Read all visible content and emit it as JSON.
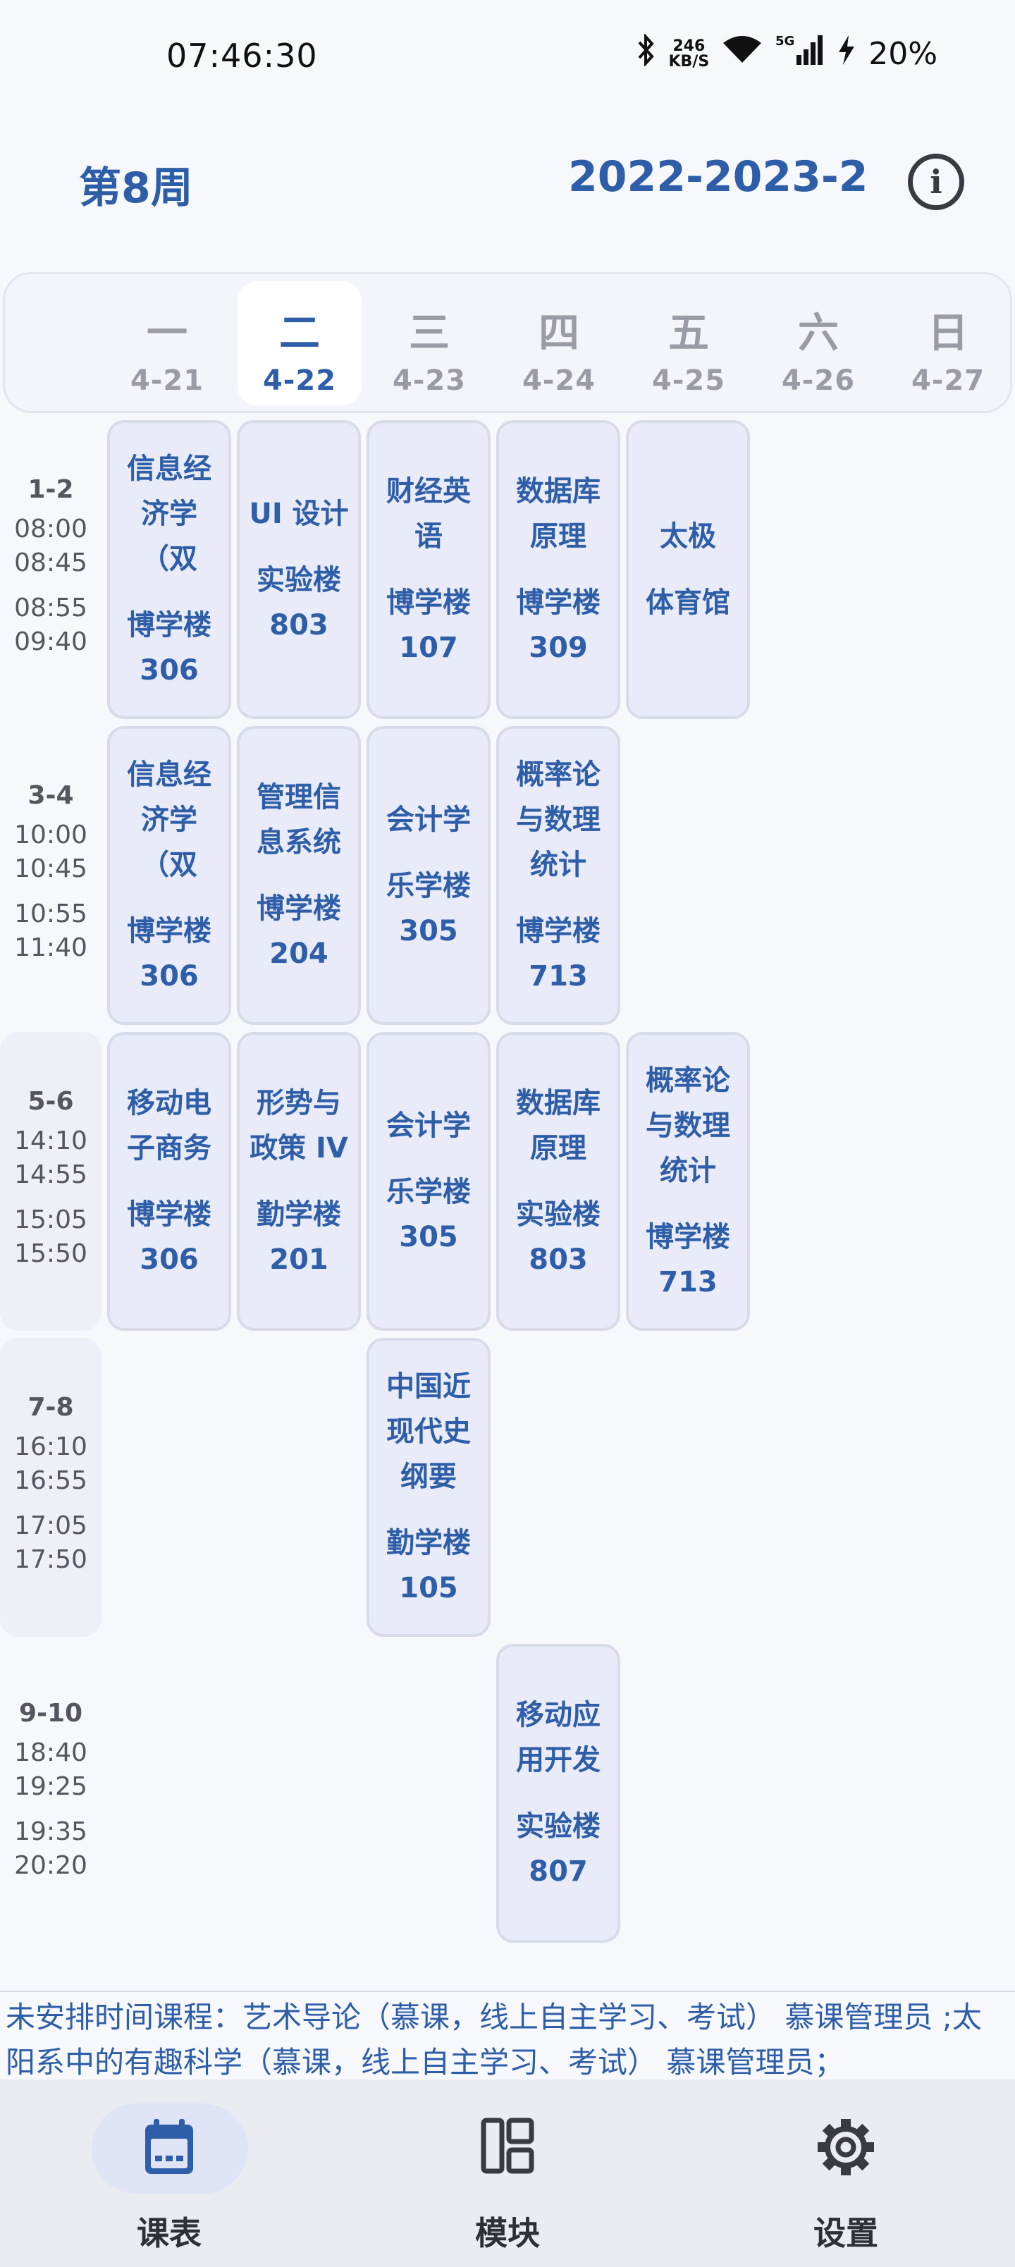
{
  "status_bar": {
    "time": "07:46:30",
    "net_speed_value": "246",
    "net_speed_unit": "KB/S",
    "network": "5G",
    "battery": "20%"
  },
  "header": {
    "week": "第8周",
    "term": "2022-2023-2",
    "info_icon": "info-icon"
  },
  "days": [
    {
      "name": "一",
      "date": "4-21"
    },
    {
      "name": "二",
      "date": "4-22"
    },
    {
      "name": "三",
      "date": "4-23"
    },
    {
      "name": "四",
      "date": "4-24"
    },
    {
      "name": "五",
      "date": "4-25"
    },
    {
      "name": "六",
      "date": "4-26"
    },
    {
      "name": "日",
      "date": "4-27"
    }
  ],
  "active_day": "二",
  "slots": [
    {
      "label": "1-2",
      "t1": "08:00",
      "t2": "08:45",
      "t3": "08:55",
      "t4": "09:40"
    },
    {
      "label": "3-4",
      "t1": "10:00",
      "t2": "10:45",
      "t3": "10:55",
      "t4": "11:40"
    },
    {
      "label": "5-6",
      "t1": "14:10",
      "t2": "14:55",
      "t3": "15:05",
      "t4": "15:50"
    },
    {
      "label": "7-8",
      "t1": "16:10",
      "t2": "16:55",
      "t3": "17:05",
      "t4": "17:50"
    },
    {
      "label": "9-10",
      "t1": "18:40",
      "t2": "19:25",
      "t3": "19:35",
      "t4": "20:20"
    }
  ],
  "courses": {
    "c_1_1": {
      "name": "信息经济学（双语…",
      "room": "博学楼\n306"
    },
    "c_1_2": {
      "name": "UI 设计",
      "room": "实验楼\n803"
    },
    "c_1_3": {
      "name": "财经英语",
      "room": "博学楼\n107"
    },
    "c_1_4": {
      "name": "数据库原理",
      "room": "博学楼\n309"
    },
    "c_1_5": {
      "name": "太极",
      "room": "体育馆"
    },
    "c_2_1": {
      "name": "信息经济学（双语…",
      "room": "博学楼\n306"
    },
    "c_2_2": {
      "name": "管理信息系统",
      "room": "博学楼\n204"
    },
    "c_2_3": {
      "name": "会计学",
      "room": "乐学楼\n305"
    },
    "c_2_4": {
      "name": "概率论与数理统计",
      "room": "博学楼\n713"
    },
    "c_3_1": {
      "name": "移动电子商务",
      "room": "博学楼\n306"
    },
    "c_3_2": {
      "name": "形势与政策 IV",
      "room": "勤学楼\n201"
    },
    "c_3_3": {
      "name": "会计学",
      "room": "乐学楼\n305"
    },
    "c_3_4": {
      "name": "数据库原理",
      "room": "实验楼\n803"
    },
    "c_3_5": {
      "name": "概率论与数理统计",
      "room": "博学楼\n713"
    },
    "c_4_3": {
      "name": "中国近现代史纲要",
      "room": "勤学楼\n105"
    },
    "c_5_4": {
      "name": "移动应用开发",
      "room": "实验楼\n807"
    }
  },
  "unscheduled": "未安排时间课程：艺术导论（慕课，线上自主学习、考试） 慕课管理员 ;太阳系中的有趣科学（慕课，线上自主学习、考试） 慕课管理员；",
  "nav": [
    {
      "label": "课表",
      "icon": "calendar-icon"
    },
    {
      "label": "模块",
      "icon": "modules-icon"
    },
    {
      "label": "设置",
      "icon": "gear-icon"
    }
  ],
  "colors": {
    "accent": "#2e5ea8",
    "card_bg": "#e9ebf8",
    "nav_active_pill": "#dfe5f7"
  }
}
